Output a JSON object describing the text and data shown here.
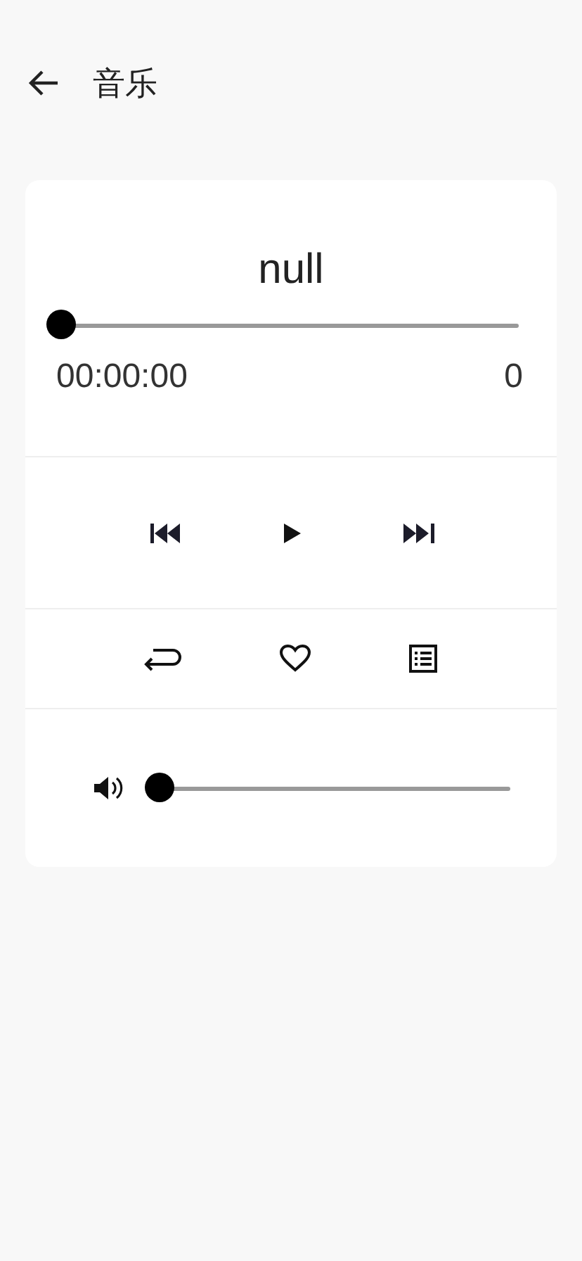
{
  "header": {
    "title": "音乐"
  },
  "player": {
    "song_title": "null",
    "progress": {
      "level": 0
    },
    "elapsed": "00:00:00",
    "duration": "0",
    "playing": false,
    "favorited": false,
    "volume": {
      "level": 0
    }
  }
}
